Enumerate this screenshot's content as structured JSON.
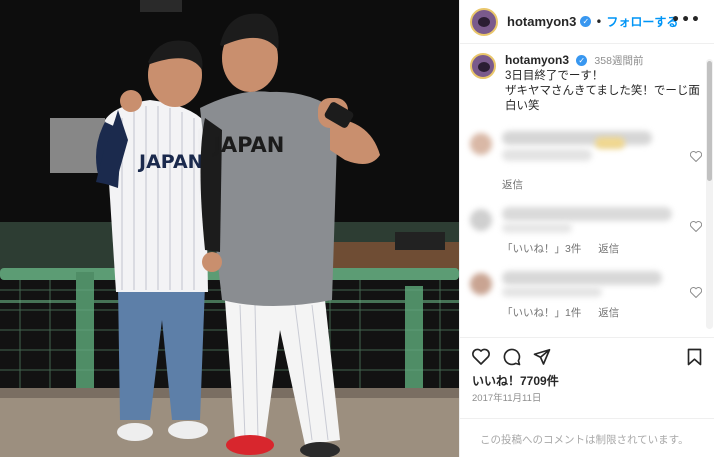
{
  "post": {
    "username": "hotamyon3",
    "verified_icon": "verified-badge-icon",
    "separator": "•",
    "follow_label": "フォローする",
    "more_label": "•••"
  },
  "photo": {
    "jersey_left_text": "JAPAN",
    "shirt_right_text": "JAPAN"
  },
  "caption": {
    "username": "hotamyon3",
    "time": "358週間前",
    "text_line1": "3日目終了でーす！",
    "text_line2": "ザキヤマさんきてました笑！でーじ面",
    "text_line3": "白い笑"
  },
  "comments": [
    {
      "meta": [
        "返信"
      ],
      "blurred": true
    },
    {
      "meta": [
        "「いいね！」3件",
        "返信"
      ],
      "blurred": true
    },
    {
      "meta": [
        "「いいね！」1件",
        "返信"
      ],
      "blurred": true
    }
  ],
  "actions": {
    "icons": [
      "heart-icon",
      "comment-icon",
      "share-icon",
      "bookmark-icon"
    ]
  },
  "likes_text": "いいね！7709件",
  "date_text": "2017年11月11日",
  "comments_restricted_text": "この投稿へのコメントは制限されています。",
  "colors": {
    "accent": "#0095f6",
    "verified": "#3897f0",
    "jersey_navy": "#1b2a4d",
    "shirt_gray": "#8a8d91",
    "fence_green": "#5c9c74"
  }
}
